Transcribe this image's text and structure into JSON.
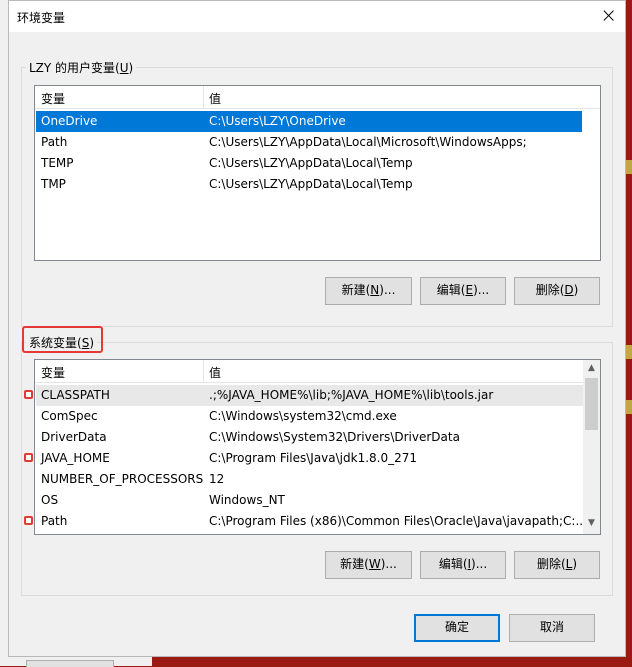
{
  "dialog": {
    "title": "环境变量",
    "close_icon": "×"
  },
  "user_group": {
    "label_prefix": "LZY 的用户变量(",
    "label_key": "U",
    "label_suffix": ")",
    "col_variable": "变量",
    "col_value": "值",
    "rows": [
      {
        "name": "OneDrive",
        "value": "C:\\Users\\LZY\\OneDrive"
      },
      {
        "name": "Path",
        "value": "C:\\Users\\LZY\\AppData\\Local\\Microsoft\\WindowsApps;"
      },
      {
        "name": "TEMP",
        "value": "C:\\Users\\LZY\\AppData\\Local\\Temp"
      },
      {
        "name": "TMP",
        "value": "C:\\Users\\LZY\\AppData\\Local\\Temp"
      }
    ],
    "btn_new": {
      "pre": "新建(",
      "key": "N",
      "post": ")..."
    },
    "btn_edit": {
      "pre": "编辑(",
      "key": "E",
      "post": ")..."
    },
    "btn_delete": {
      "pre": "删除(",
      "key": "D",
      "post": ")"
    }
  },
  "system_group": {
    "label_prefix": "系统变量(",
    "label_key": "S",
    "label_suffix": ")",
    "col_variable": "变量",
    "col_value": "值",
    "rows": [
      {
        "name": "CLASSPATH",
        "value": ".;%JAVA_HOME%\\lib;%JAVA_HOME%\\lib\\tools.jar"
      },
      {
        "name": "ComSpec",
        "value": "C:\\Windows\\system32\\cmd.exe"
      },
      {
        "name": "DriverData",
        "value": "C:\\Windows\\System32\\Drivers\\DriverData"
      },
      {
        "name": "JAVA_HOME",
        "value": "C:\\Program Files\\Java\\jdk1.8.0_271"
      },
      {
        "name": "NUMBER_OF_PROCESSORS",
        "value": "12"
      },
      {
        "name": "OS",
        "value": "Windows_NT"
      },
      {
        "name": "Path",
        "value": "C:\\Program Files (x86)\\Common Files\\Oracle\\Java\\javapath;C:..."
      }
    ],
    "btn_new": {
      "pre": "新建(",
      "key": "W",
      "post": ")..."
    },
    "btn_edit": {
      "pre": "编辑(",
      "key": "I",
      "post": ")..."
    },
    "btn_delete": {
      "pre": "删除(",
      "key": "L",
      "post": ")"
    }
  },
  "footer": {
    "ok": "确定",
    "cancel": "取消"
  },
  "colors": {
    "selection": "#0078d7",
    "highlight": "#e53935",
    "background": "#9b1b12"
  }
}
